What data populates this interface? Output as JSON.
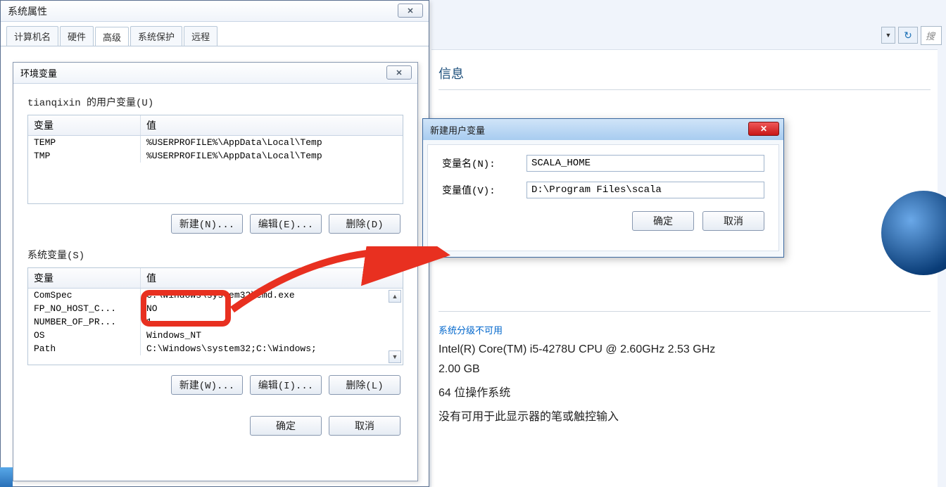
{
  "bg": {
    "search_placeholder": "搜",
    "section_title": "信息",
    "rating_link": "系统分级不可用",
    "cpu": "Intel(R) Core(TM) i5-4278U CPU @ 2.60GHz   2.53 GHz",
    "ram": "2.00 GB",
    "systype": "64 位操作系统",
    "pen": "没有可用于此显示器的笔或触控输入"
  },
  "sysprops": {
    "title": "系统属性",
    "tabs": [
      "计算机名",
      "硬件",
      "高级",
      "系统保护",
      "远程"
    ],
    "active_tab": 2
  },
  "envvar": {
    "title": "环境变量",
    "user_group_label": "tianqixin 的用户变量(U)",
    "col_var": "变量",
    "col_val": "值",
    "user_rows": [
      {
        "name": "TEMP",
        "value": "%USERPROFILE%\\AppData\\Local\\Temp"
      },
      {
        "name": "TMP",
        "value": "%USERPROFILE%\\AppData\\Local\\Temp"
      }
    ],
    "user_buttons": {
      "new": "新建(N)...",
      "edit": "编辑(E)...",
      "del": "删除(D)"
    },
    "sys_group_label": "系统变量(S)",
    "sys_rows": [
      {
        "name": "ComSpec",
        "value": "C:\\Windows\\system32\\cmd.exe"
      },
      {
        "name": "FP_NO_HOST_C...",
        "value": "NO"
      },
      {
        "name": "NUMBER_OF_PR...",
        "value": "1"
      },
      {
        "name": "OS",
        "value": "Windows_NT"
      },
      {
        "name": "Path",
        "value": "C:\\Windows\\system32;C:\\Windows;"
      }
    ],
    "sys_buttons": {
      "new": "新建(W)...",
      "edit": "编辑(I)...",
      "del": "删除(L)"
    },
    "ok": "确定",
    "cancel": "取消"
  },
  "newvar": {
    "title": "新建用户变量",
    "name_label": "变量名(N):",
    "value_label": "变量值(V):",
    "name_value": "SCALA_HOME",
    "value_value": "D:\\Program Files\\scala",
    "ok": "确定",
    "cancel": "取消"
  }
}
